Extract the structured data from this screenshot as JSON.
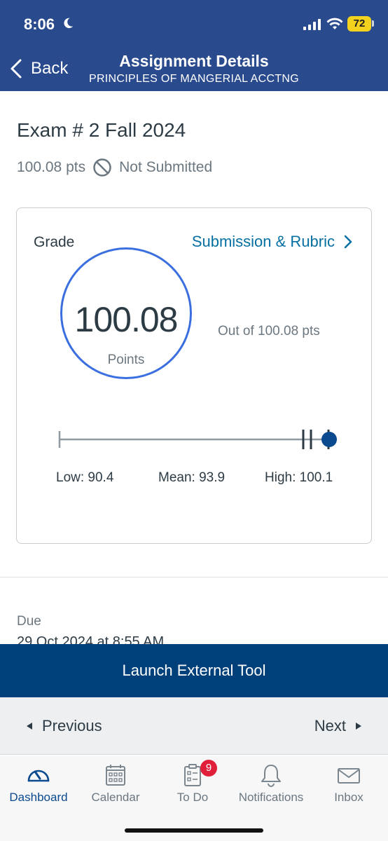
{
  "status": {
    "time": "8:06",
    "battery": "72"
  },
  "header": {
    "back_label": "Back",
    "title": "Assignment Details",
    "subtitle": "PRINCIPLES OF MANGERIAL ACCTNG"
  },
  "assignment": {
    "title": "Exam # 2 Fall 2024",
    "points": "100.08 pts",
    "submission_status": "Not Submitted"
  },
  "grade": {
    "label": "Grade",
    "link": "Submission & Rubric",
    "score": "100.08",
    "score_label": "Points",
    "out_of": "Out of 100.08 pts",
    "stats": {
      "low": "Low: 90.4",
      "mean": "Mean: 93.9",
      "high": "High: 100.1"
    }
  },
  "due": {
    "label": "Due",
    "value": "29 Oct 2024 at 8:55 AM"
  },
  "launch_label": "Launch External Tool",
  "pager": {
    "previous": "Previous",
    "next": "Next"
  },
  "tabs": [
    {
      "label": "Dashboard",
      "icon": "dashboard-icon"
    },
    {
      "label": "Calendar",
      "icon": "calendar-icon"
    },
    {
      "label": "To Do",
      "icon": "todo-icon",
      "badge": "9"
    },
    {
      "label": "Notifications",
      "icon": "bell-icon"
    },
    {
      "label": "Inbox",
      "icon": "inbox-icon"
    }
  ],
  "colors": {
    "header": "#2a4a8e",
    "launch": "#00407a",
    "link": "#0770a3",
    "ring": "#3b6fe0",
    "badge": "#e0203a"
  }
}
